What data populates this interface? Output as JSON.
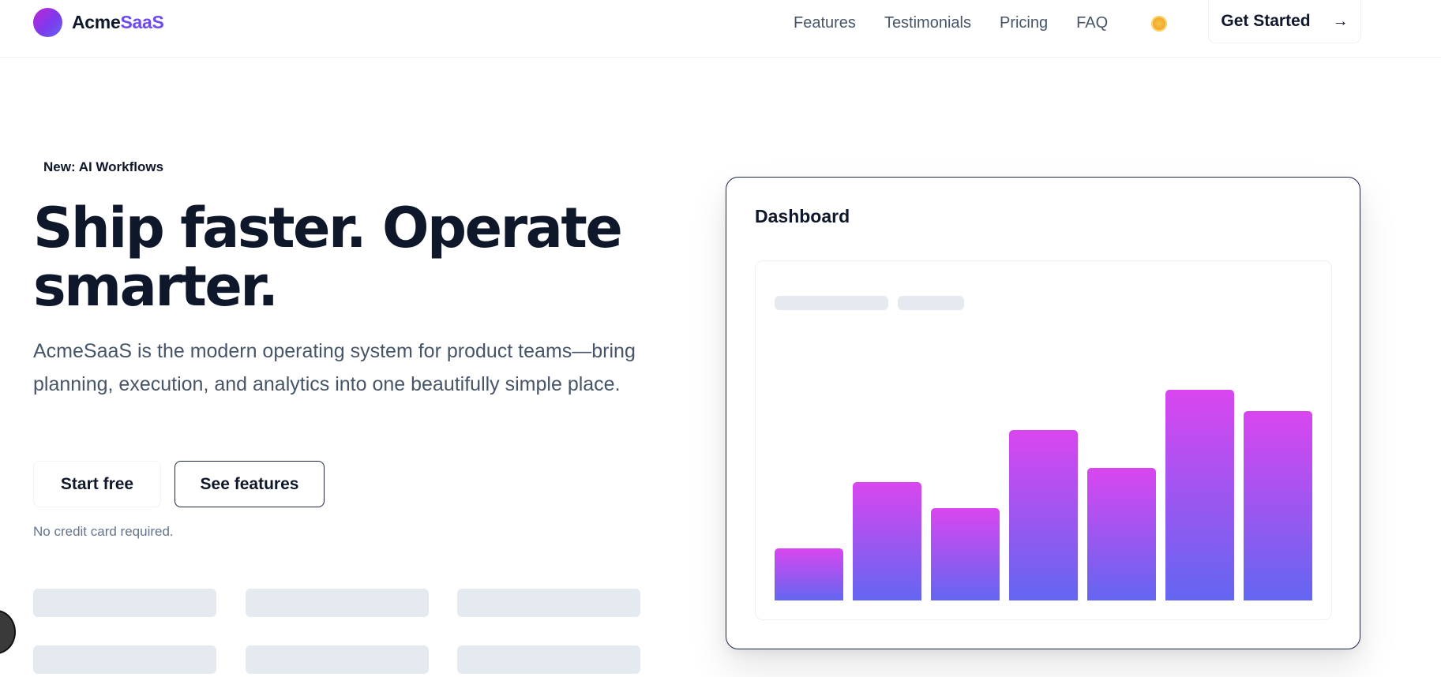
{
  "header": {
    "brand_prefix": "Acme",
    "brand_suffix": "SaaS",
    "nav": [
      {
        "label": "Features"
      },
      {
        "label": "Testimonials"
      },
      {
        "label": "Pricing"
      },
      {
        "label": "FAQ"
      }
    ],
    "theme_icon": "sun-icon",
    "cta_label": "Get Started",
    "cta_icon": "arrow-right-icon"
  },
  "hero": {
    "badge": "New: AI Workflows",
    "title_line1": "Ship faster. Operate",
    "title_line2": "smarter.",
    "subtitle": "AcmeSaaS is the modern operating system for product teams—bring planning, execution, and analytics into one beautifully simple place.",
    "primary_button": "Start free",
    "secondary_button": "See features",
    "note": "No credit card required."
  },
  "dashboard": {
    "title": "Dashboard",
    "chart_data": {
      "type": "bar",
      "values": [
        22,
        50,
        39,
        72,
        56,
        89,
        80
      ],
      "ylim": [
        0,
        100
      ]
    }
  },
  "colors": {
    "accent": "#6d4bf0",
    "bar_top": "#d946ef",
    "bar_bottom": "#6366f1",
    "skeleton": "#e5e9f0"
  }
}
